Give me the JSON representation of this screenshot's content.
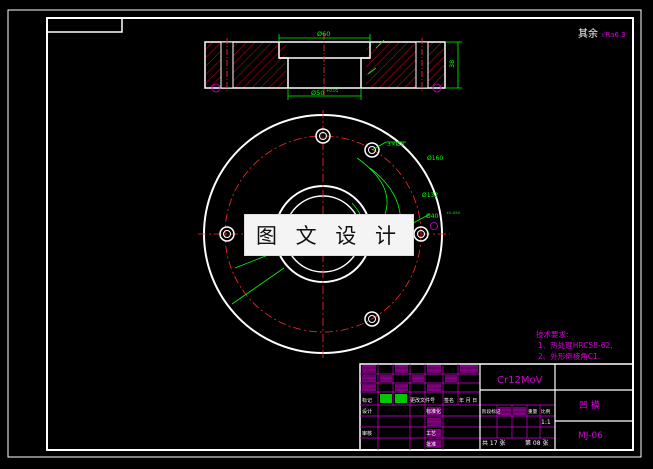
{
  "top_right_note": "其余",
  "roughness_symbol": "√Ra6.3",
  "dimensions": {
    "top_width": "Ø60",
    "bottom_width": "Ø50",
    "bottom_tolerance": "+0.05",
    "height": "38",
    "hole_spec": "3×Ø8",
    "pcd": "Ø160",
    "dia_132": "Ø132",
    "bore": "Ø40",
    "bore_tolerance": "+0.050"
  },
  "watermark": "图 文 设 计",
  "technical_requirements": {
    "title": "技术要求:",
    "items": [
      "1、热处理HRC58-62,",
      "2、外形倒棱角C1."
    ]
  },
  "title_block": {
    "material": "Cr12MoV",
    "part_name": "凹   模",
    "drawing_no": "MJ-06",
    "scale": "1:1",
    "sheet_label": "共 17 张",
    "sheet_no": "第 08 张",
    "labels": {
      "mark": "标记",
      "count": "处数",
      "change_doc": "更改文件号",
      "signature": "签名",
      "date": "年 月 日",
      "design": "设计",
      "standardize": "标准化",
      "review": "审核",
      "craft": "工艺",
      "approve": "批准",
      "stage_mark": "阶段标记",
      "weight": "重量",
      "scale": "比例"
    }
  }
}
